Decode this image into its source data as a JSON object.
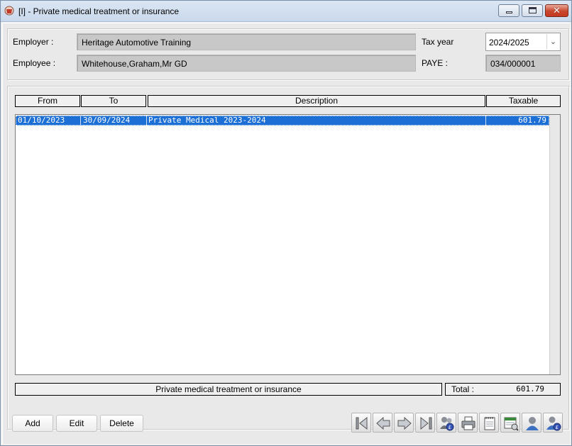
{
  "window": {
    "title": "[I] - Private medical treatment or insurance",
    "close_glyph": "✕"
  },
  "header": {
    "employer_label": "Employer :",
    "employer_value": "Heritage Automotive Training",
    "employee_label": "Employee :",
    "employee_value": "Whitehouse,Graham,Mr GD",
    "taxyear_label": "Tax year",
    "taxyear_value": "2024/2025",
    "paye_label": "PAYE :",
    "paye_value": "034/000001"
  },
  "grid": {
    "columns": [
      "From",
      "To",
      "Description",
      "Taxable"
    ],
    "rows": [
      {
        "from": "01/10/2023",
        "to": "30/09/2024",
        "description": "Private Medical 2023-2024",
        "taxable": "601.79"
      }
    ]
  },
  "footer": {
    "caption": "Private medical treatment or insurance",
    "total_label": "Total :",
    "total_value": "601.79"
  },
  "buttons": {
    "add": "Add",
    "edit": "Edit",
    "delete": "Delete"
  },
  "toolbar_icons": [
    "first-record-icon",
    "previous-record-icon",
    "next-record-icon",
    "last-record-icon",
    "employee-pay-icon",
    "print-icon",
    "notes-icon",
    "calendar-report-icon",
    "employee-icon",
    "employee-pay-alt-icon"
  ],
  "colors": {
    "selection": "#1c6fd5",
    "close_button": "#c9462c"
  }
}
